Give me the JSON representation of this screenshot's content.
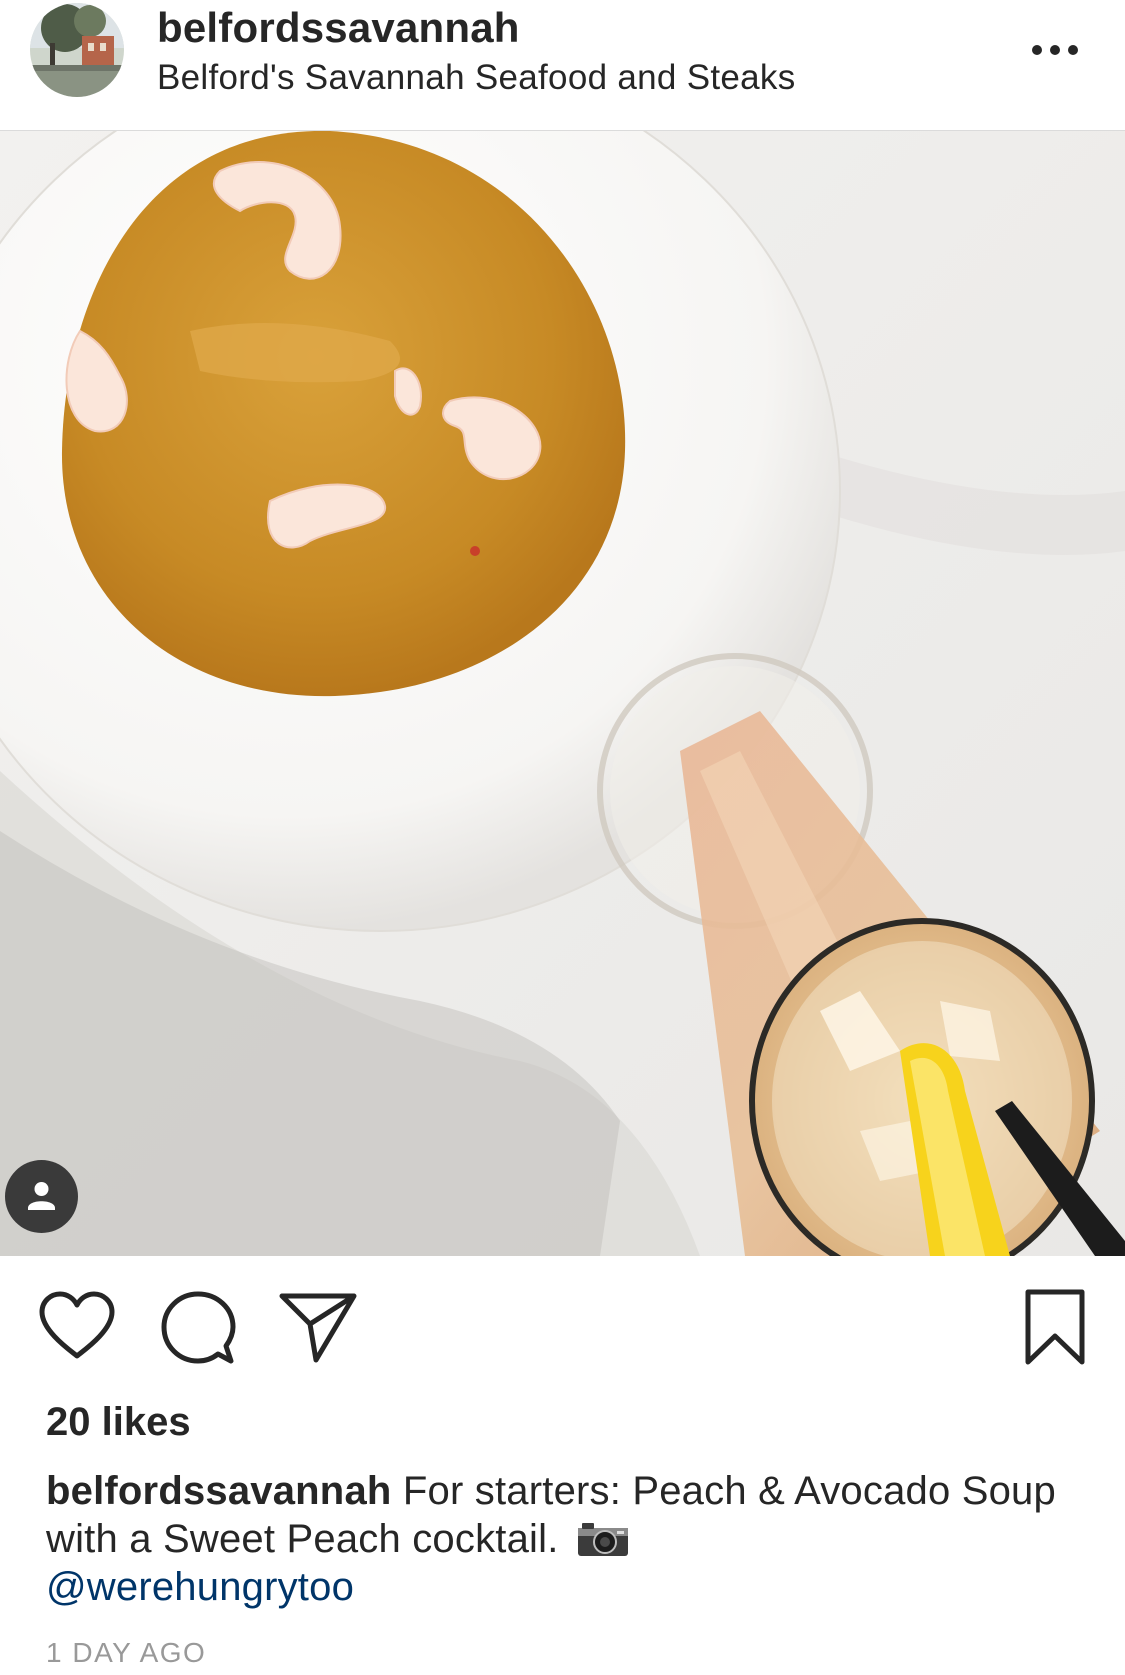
{
  "post": {
    "username": "belfordssavannah",
    "location": "Belford's Savannah Seafood and Steaks",
    "likes": "20 likes",
    "caption": {
      "username": "belfordssavannah",
      "text": "For starters: Peach & Avocado Soup with a Sweet Peach cocktail.",
      "emoji": "camera-icon",
      "mention": "@werehungrytoo"
    },
    "timestamp": "1 DAY AGO"
  },
  "icons": {
    "more": "ellipsis-icon",
    "like": "heart-icon",
    "comment": "comment-bubble-icon",
    "share": "paper-plane-icon",
    "save": "bookmark-icon",
    "tag": "person-icon"
  },
  "colors": {
    "text": "#262626",
    "mention": "#003569",
    "muted": "#999999",
    "divider": "#dbdbdb",
    "soup": "#c98d2a",
    "shrimp": "#fbe6da"
  }
}
